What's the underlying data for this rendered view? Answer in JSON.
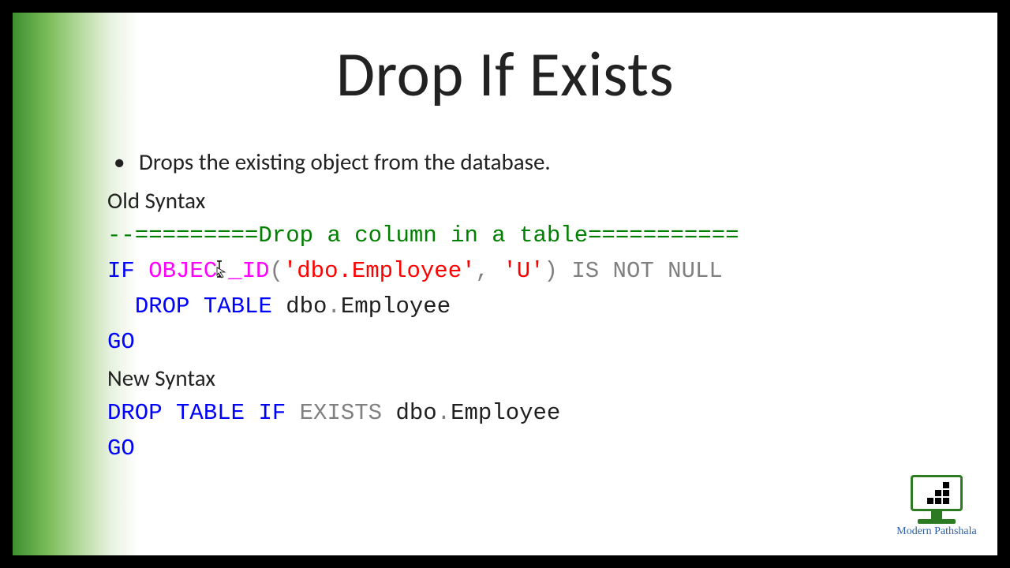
{
  "title": "Drop If Exists",
  "bullet": "Drops the existing object from the database.",
  "old_syntax_label": "Old Syntax",
  "new_syntax_label": "New Syntax",
  "code": {
    "comment": "--=========Drop a column in a table===========",
    "line1": {
      "if": "IF",
      "object": "OBJEC",
      "object2": "_ID",
      "paren_o": "(",
      "str1": "'dbo.Employee'",
      "comma": ",",
      "str2": "'U'",
      "paren_c": ")",
      "isnotnull": "IS NOT NULL"
    },
    "line2": {
      "drop_table": "DROP TABLE",
      "dbo": "dbo",
      "dot": ".",
      "emp": "Employee"
    },
    "go": "GO",
    "line3": {
      "drop_table": "DROP TABLE",
      "if_exists": "IF EXISTS",
      "dbo": "dbo",
      "dot": ".",
      "emp": "Employee"
    }
  },
  "logo_caption": "Modern Pathshala"
}
